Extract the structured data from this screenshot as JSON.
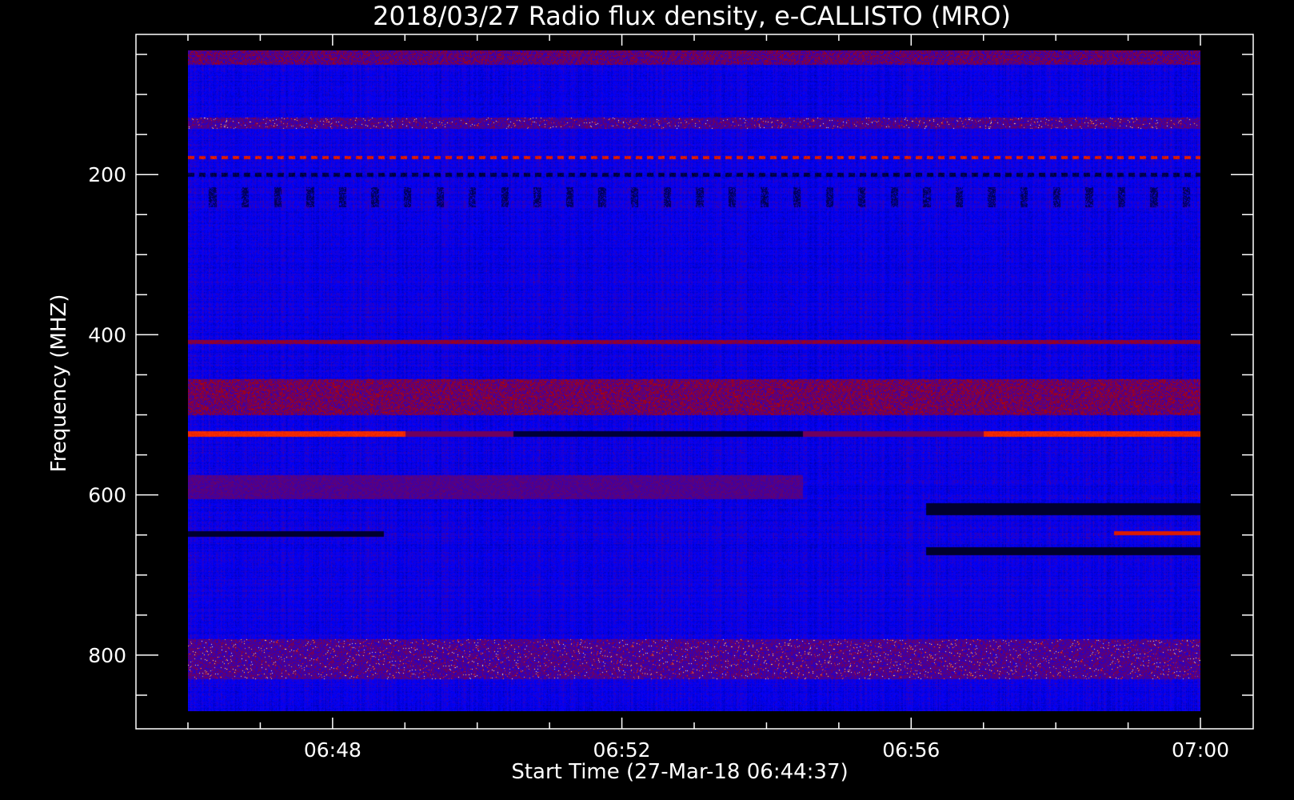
{
  "chart_data": {
    "type": "heatmap",
    "title": "2018/03/27  Radio flux density, e-CALLISTO (MRO)",
    "xlabel": "Start Time (27-Mar-18 06:44:37)",
    "ylabel": "Frequency (MHZ)",
    "x_range_minutes": [
      46.0,
      60.0
    ],
    "x_ticks": [
      {
        "minute": 48,
        "label": "06:48"
      },
      {
        "minute": 52,
        "label": "06:52"
      },
      {
        "minute": 56,
        "label": "06:56"
      },
      {
        "minute": 60,
        "label": "07:00"
      }
    ],
    "y_range_mhz": [
      45,
      870
    ],
    "y_ticks": [
      {
        "mhz": 200,
        "label": "200"
      },
      {
        "mhz": 400,
        "label": "400"
      },
      {
        "mhz": 600,
        "label": "600"
      },
      {
        "mhz": 800,
        "label": "800"
      }
    ],
    "colormap": [
      "#000000",
      "#0000ff",
      "#b00000",
      "#ff3000",
      "#ffe060",
      "#ffffff"
    ],
    "background_level": 0.28,
    "features": [
      {
        "f_lo": 45,
        "f_hi": 62,
        "level": 0.4,
        "kind": "noise"
      },
      {
        "f_lo": 128,
        "f_hi": 142,
        "level": 0.45,
        "kind": "bursts"
      },
      {
        "f_lo": 176,
        "f_hi": 180,
        "level": 0.6,
        "kind": "dashed"
      },
      {
        "f_lo": 197,
        "f_hi": 202,
        "level": 0.08,
        "kind": "dashed"
      },
      {
        "f_lo": 215,
        "f_hi": 240,
        "level": 0.1,
        "kind": "periodic_dark"
      },
      {
        "f_lo": 406,
        "f_hi": 411,
        "level": 0.45,
        "kind": "line"
      },
      {
        "f_lo": 455,
        "f_hi": 500,
        "level": 0.42,
        "kind": "noise"
      },
      {
        "f_lo": 520,
        "f_hi": 527,
        "level": 0.62,
        "kind": "time_varying_bright"
      },
      {
        "f_lo": 575,
        "f_hi": 605,
        "level": 0.38,
        "kind": "early_band"
      },
      {
        "f_lo": 610,
        "f_hi": 625,
        "level": 0.05,
        "kind": "late_dark"
      },
      {
        "f_lo": 645,
        "f_hi": 652,
        "level": 0.05,
        "kind": "early_dark"
      },
      {
        "f_lo": 645,
        "f_hi": 650,
        "level": 0.6,
        "kind": "late_bright"
      },
      {
        "f_lo": 665,
        "f_hi": 675,
        "level": 0.05,
        "kind": "late_dark"
      },
      {
        "f_lo": 780,
        "f_hi": 830,
        "level": 0.55,
        "kind": "bursts"
      }
    ]
  }
}
